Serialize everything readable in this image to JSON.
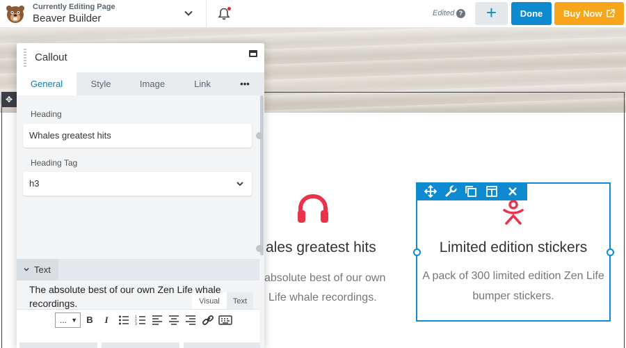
{
  "topbar": {
    "editing_label": "Currently Editing Page",
    "page_name": "Beaver Builder",
    "status": "Edited",
    "help_glyph": "?",
    "add_glyph": "+",
    "done_label": "Done",
    "buy_label": "Buy Now"
  },
  "row": {
    "move_glyph": "✥"
  },
  "modules": [
    {
      "heading": "ales greatest hits",
      "text_line1": "absolute best of our own",
      "text_line2": "Life whale recordings.",
      "icon": "headphones-icon",
      "icon_color": "#e8334a"
    },
    {
      "heading": "Limited edition stickers",
      "text": "A pack of 300 limited edition Zen Life bumper stickers.",
      "icon": "person-sticker-icon",
      "icon_color": "#e8334a"
    }
  ],
  "panel": {
    "title": "Callout",
    "tabs": [
      "General",
      "Style",
      "Image",
      "Link",
      "•••"
    ],
    "active_tab": "General",
    "heading_label": "Heading",
    "heading_value": "Whales greatest hits",
    "heading_tag_label": "Heading Tag",
    "heading_tag_value": "h3",
    "text_section": "Text",
    "editor_modes": [
      "Visual",
      "Text"
    ],
    "format_select": "...",
    "toolbar": [
      "B",
      "I"
    ],
    "editor_text": "The absolute best of our own Zen Life whale recordings."
  },
  "colors": {
    "accent": "#0e8ad0",
    "buy": "#f7a51a",
    "icon": "#e8334a"
  }
}
